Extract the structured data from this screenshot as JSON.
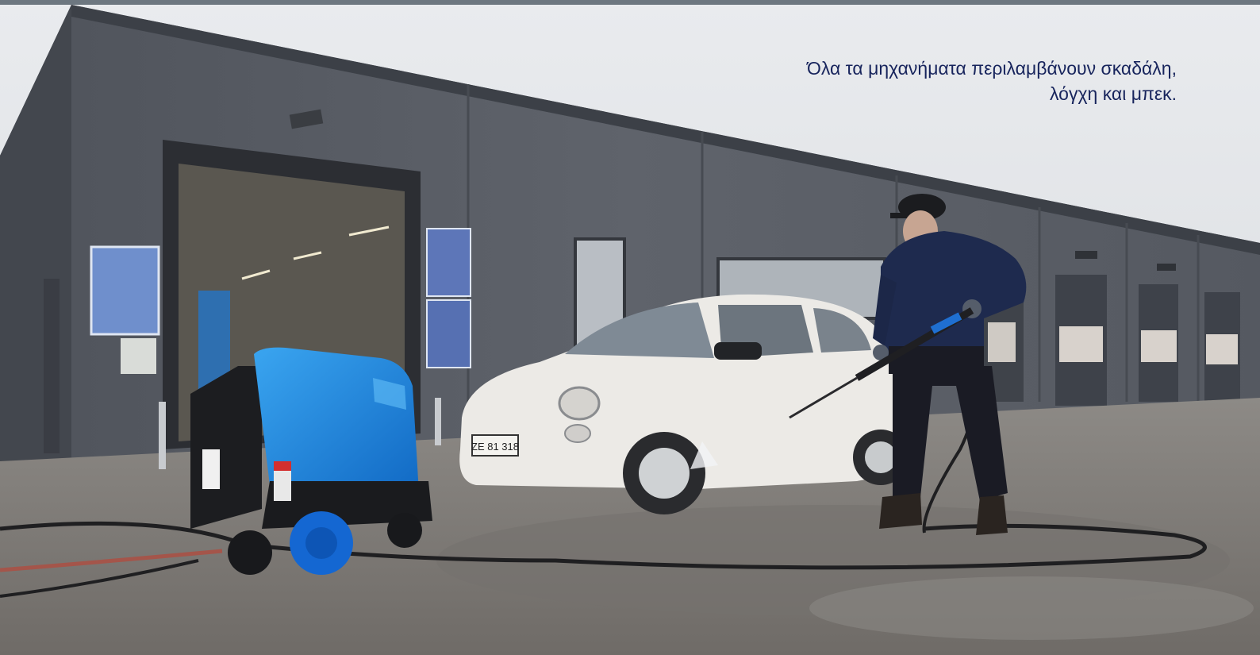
{
  "caption": {
    "line1": "Όλα τα μηχανήματα περιλαμβάνουν σκαδάλη,",
    "line2": "λόγχη και μπεκ."
  },
  "colors": {
    "caption_text": "#17245c",
    "top_bar": "#6d7780",
    "machine_blue": "#1e8fe0",
    "building_gray": "#5c6068"
  },
  "plate_text": "ZE 81 318"
}
